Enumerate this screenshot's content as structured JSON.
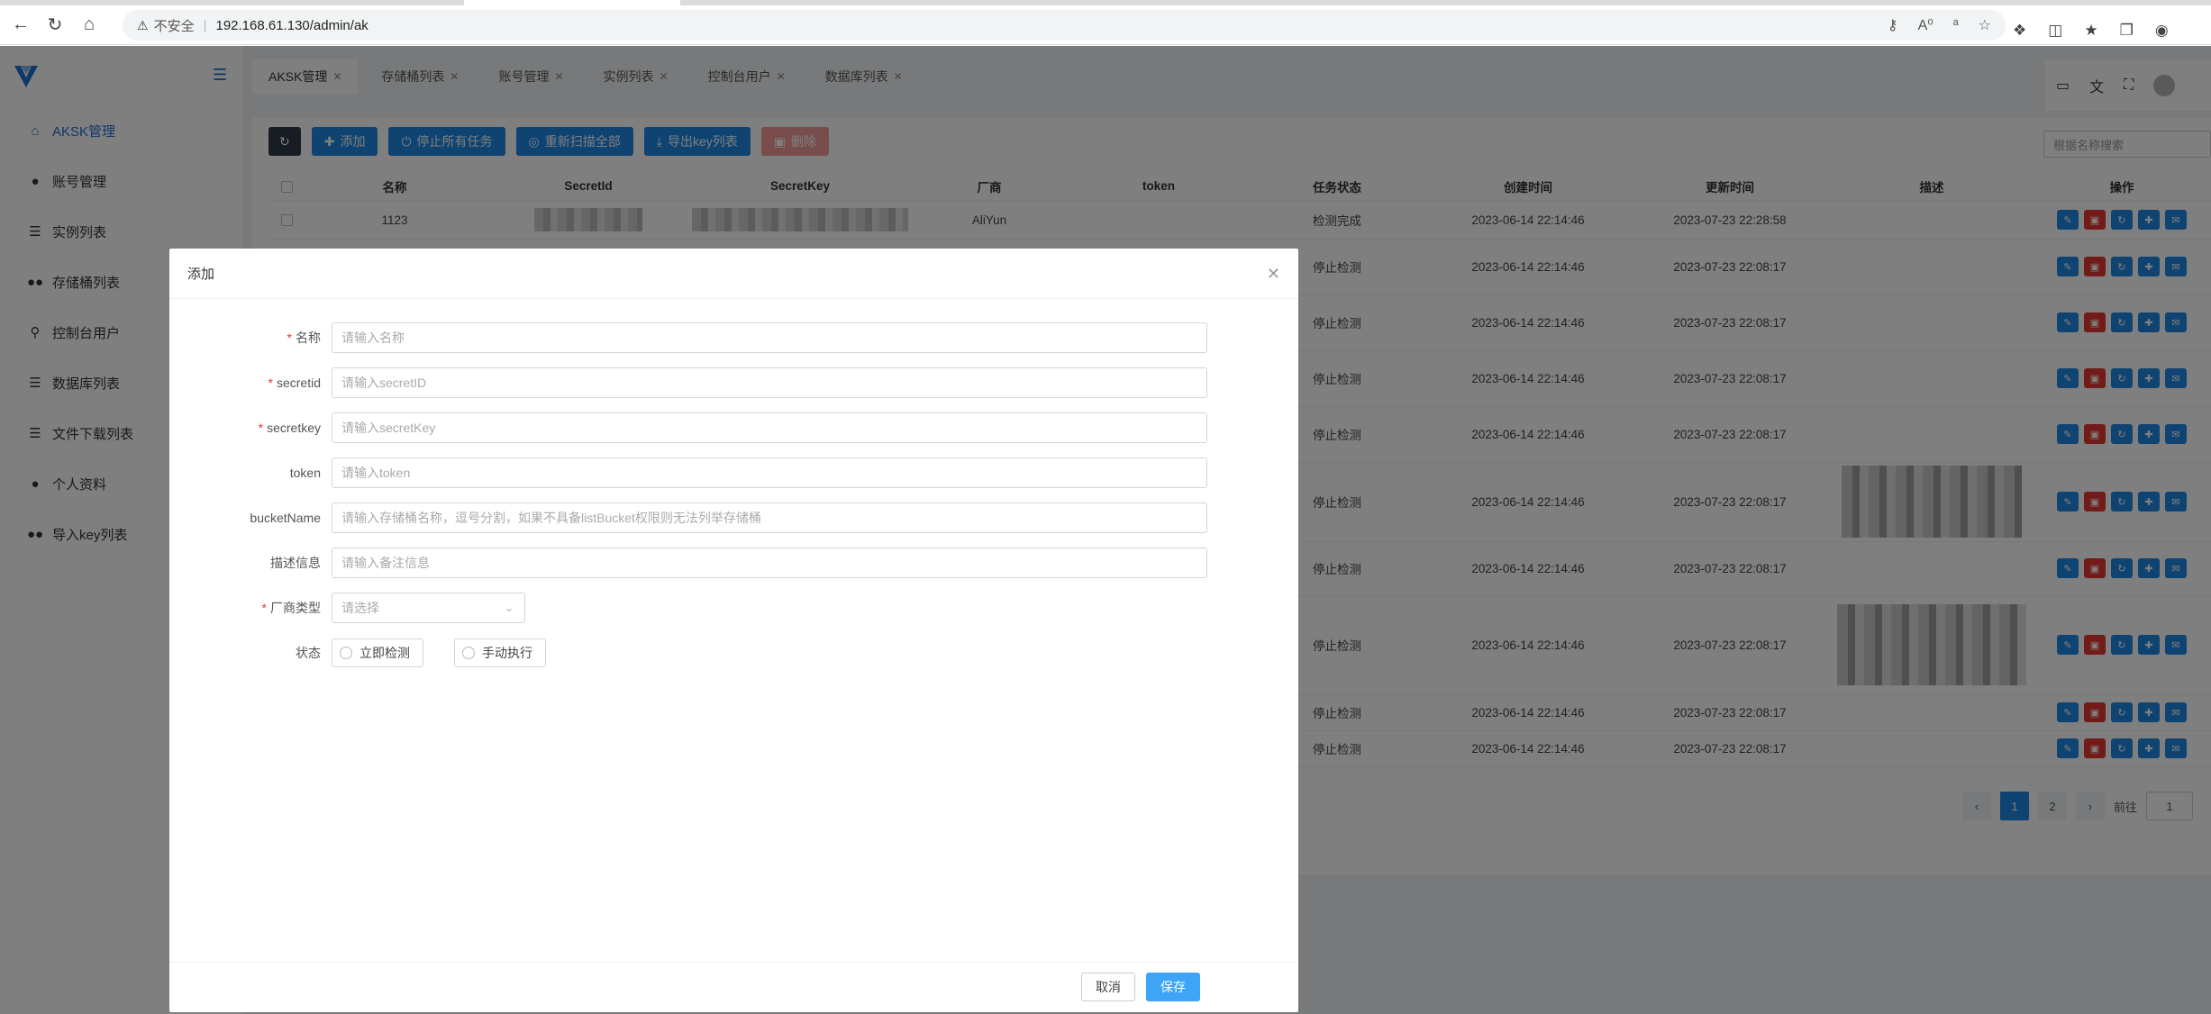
{
  "browser": {
    "insecure_label": "不安全",
    "url": "192.168.61.130/admin/ak"
  },
  "sidebar": {
    "items": [
      {
        "label": "AKSK管理",
        "icon": "home-icon"
      },
      {
        "label": "账号管理",
        "icon": "user-icon"
      },
      {
        "label": "实例列表",
        "icon": "list-icon"
      },
      {
        "label": "存储桶列表",
        "icon": "users-icon"
      },
      {
        "label": "控制台用户",
        "icon": "lock-icon"
      },
      {
        "label": "数据库列表",
        "icon": "list-icon"
      },
      {
        "label": "文件下载列表",
        "icon": "list-icon"
      },
      {
        "label": "个人资料",
        "icon": "user-icon"
      },
      {
        "label": "导入key列表",
        "icon": "users-icon"
      }
    ]
  },
  "tabs": [
    "AKSK管理",
    "存储桶列表",
    "账号管理",
    "实例列表",
    "控制台用户",
    "数据库列表"
  ],
  "toolbar": {
    "add": "添加",
    "stop_all": "停止所有任务",
    "rescan": "重新扫描全部",
    "export": "导出key列表",
    "delete": "删除"
  },
  "search_placeholder": "根据名称搜索",
  "table": {
    "headers": [
      "名称",
      "SecretId",
      "SecretKey",
      "厂商",
      "token",
      "任务状态",
      "创建时间",
      "更新时间",
      "描述",
      "操作"
    ],
    "rows": [
      {
        "name": "1123",
        "vendor": "AliYun",
        "status": "检测完成",
        "created": "2023-06-14 22:14:46",
        "updated": "2023-07-23 22:28:58"
      },
      {
        "name": "",
        "vendor": "",
        "status": "停止检测",
        "created": "2023-06-14 22:14:46",
        "updated": "2023-07-23 22:08:17"
      },
      {
        "name": "",
        "vendor": "",
        "status": "停止检测",
        "created": "2023-06-14 22:14:46",
        "updated": "2023-07-23 22:08:17"
      },
      {
        "name": "",
        "vendor": "",
        "status": "停止检测",
        "created": "2023-06-14 22:14:46",
        "updated": "2023-07-23 22:08:17"
      },
      {
        "name": "",
        "vendor": "",
        "status": "停止检测",
        "created": "2023-06-14 22:14:46",
        "updated": "2023-07-23 22:08:17"
      },
      {
        "name": "",
        "vendor": "",
        "status": "停止检测",
        "created": "2023-06-14 22:14:46",
        "updated": "2023-07-23 22:08:17"
      },
      {
        "name": "",
        "vendor": "",
        "status": "停止检测",
        "created": "2023-06-14 22:14:46",
        "updated": "2023-07-23 22:08:17"
      },
      {
        "name": "",
        "vendor": "",
        "status": "停止检测",
        "created": "2023-06-14 22:14:46",
        "updated": "2023-07-23 22:08:17"
      },
      {
        "name": "",
        "vendor": "",
        "status": "停止检测",
        "created": "2023-06-14 22:14:46",
        "updated": "2023-07-23 22:08:17"
      },
      {
        "name": "",
        "vendor": "",
        "status": "停止检测",
        "created": "2023-06-14 22:14:46",
        "updated": "2023-07-23 22:08:17"
      }
    ]
  },
  "pagination": {
    "pages": [
      "1",
      "2"
    ],
    "goto_label": "前往",
    "goto_value": "1"
  },
  "modal": {
    "title": "添加",
    "fields": {
      "name": {
        "label": "名称",
        "placeholder": "请输入名称"
      },
      "secretid": {
        "label": "secretid",
        "placeholder": "请输入secretID"
      },
      "secretkey": {
        "label": "secretkey",
        "placeholder": "请输入secretKey"
      },
      "token": {
        "label": "token",
        "placeholder": "请输入token"
      },
      "bucketname": {
        "label": "bucketName",
        "placeholder": "请输入存储桶名称，逗号分割，如果不具备listBucket权限则无法列举存储桶"
      },
      "description": {
        "label": "描述信息",
        "placeholder": "请输入备注信息"
      },
      "vendor": {
        "label": "厂商类型",
        "placeholder": "请选择"
      },
      "status": {
        "label": "状态",
        "options": [
          "立即检测",
          "手动执行"
        ]
      }
    },
    "cancel": "取消",
    "save": "保存"
  },
  "colors": {
    "primary": "#1e88e5",
    "danger": "#e53935",
    "save": "#3ea4f7"
  }
}
